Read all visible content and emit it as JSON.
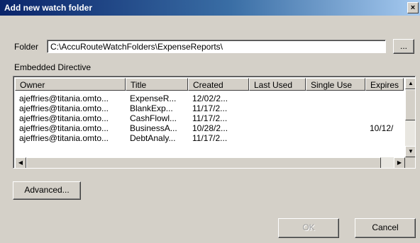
{
  "window": {
    "title": "Add new watch folder",
    "close_glyph": "×"
  },
  "folder": {
    "label": "Folder",
    "value": "C:\\AccuRouteWatchFolders\\ExpenseReports\\",
    "browse_label": "..."
  },
  "embedded_directive": {
    "label": "Embedded Directive",
    "columns": [
      "Owner",
      "Title",
      "Created",
      "Last Used",
      "Single Use",
      "Expires"
    ],
    "rows": [
      [
        "ajeffries@titania.omto...",
        "ExpenseR...",
        "12/02/2...",
        "",
        "",
        ""
      ],
      [
        "ajeffries@titania.omto...",
        "BlankExp...",
        "11/17/2...",
        "",
        "",
        ""
      ],
      [
        "ajeffries@titania.omto...",
        "CashFlowl...",
        "11/17/2...",
        "",
        "",
        ""
      ],
      [
        "ajeffries@titania.omto...",
        "BusinessA...",
        "10/28/2...",
        "",
        "",
        "10/12/"
      ],
      [
        "ajeffries@titania.omto...",
        "DebtAnaly...",
        "11/17/2...",
        "",
        "",
        ""
      ]
    ]
  },
  "buttons": {
    "advanced": "Advanced...",
    "ok": "OK",
    "cancel": "Cancel"
  },
  "icons": {
    "scroll_up": "▲",
    "scroll_down": "▼",
    "scroll_left": "◀",
    "scroll_right": "▶"
  }
}
